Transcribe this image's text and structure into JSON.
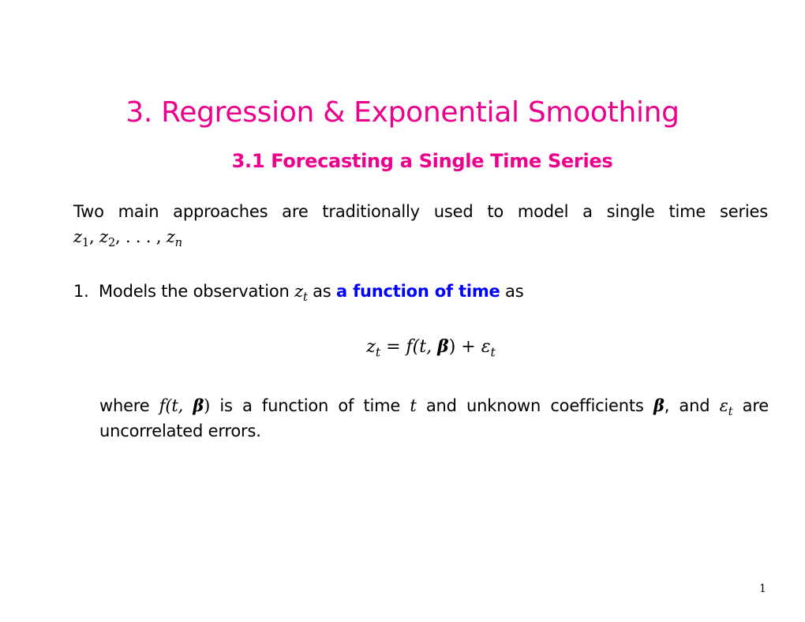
{
  "slide": {
    "title": "3. Regression & Exponential Smoothing",
    "subtitle": "3.1 Forecasting a Single Time Series",
    "intro": {
      "text": "Two main approaches are traditionally used to model a single time series",
      "series_notation": {
        "z": "z",
        "s1": "1",
        "sep1": ", ",
        "s2": "2",
        "sep2": ", . . . , ",
        "sn": "n"
      }
    },
    "item1": {
      "number": "1.",
      "text_before": "Models the observation ",
      "var": "z",
      "var_sub": "t",
      "text_mid": " as ",
      "highlight": "a function of time",
      "text_after": " as"
    },
    "equation": {
      "lhs": "z",
      "lhs_sub": "t",
      "eq": " = ",
      "f": "f",
      "args_open": "(t, ",
      "beta": "β",
      "args_close": ")",
      "plus": " + ",
      "eps": "ε",
      "eps_sub": "t"
    },
    "explanation": {
      "w1": "where ",
      "f": "f",
      "args_open": "(t, ",
      "beta": "β",
      "args_close": ")",
      "w2": " is a function of time ",
      "t": "t",
      "w3": " and unknown coefficients ",
      "beta2": "β",
      "w4": ", and ",
      "eps": "ε",
      "eps_sub": "t",
      "w5": " are",
      "line2": "uncorrelated errors."
    },
    "page_number": "1",
    "colors": {
      "heading": "#ec008c",
      "highlight": "#0000ff",
      "text": "#000000"
    }
  }
}
